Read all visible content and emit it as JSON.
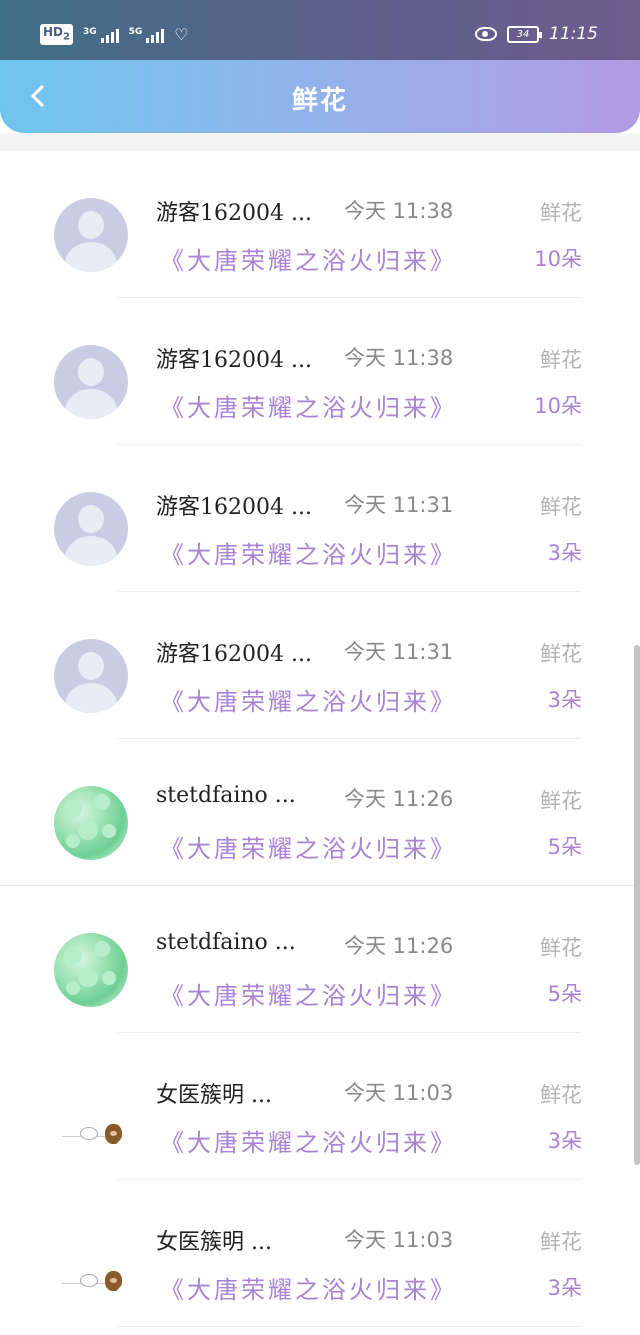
{
  "status_bar": {
    "hd": "HD",
    "hd_sim": "2",
    "sig1_label": "3G",
    "sig2_label": "5G",
    "battery": "34",
    "time": "11:15"
  },
  "header": {
    "title": "鲜花",
    "back_icon": "chevron-left-icon"
  },
  "records": [
    {
      "user": "游客162004 ...",
      "time": "今天 11:38",
      "type": "鲜花",
      "book": "《大唐荣耀之浴火归来》",
      "count": "10朵",
      "avatar": "default"
    },
    {
      "user": "游客162004 ...",
      "time": "今天 11:38",
      "type": "鲜花",
      "book": "《大唐荣耀之浴火归来》",
      "count": "10朵",
      "avatar": "default"
    },
    {
      "user": "游客162004 ...",
      "time": "今天 11:31",
      "type": "鲜花",
      "book": "《大唐荣耀之浴火归来》",
      "count": "3朵",
      "avatar": "default"
    },
    {
      "user": "游客162004 ...",
      "time": "今天 11:31",
      "type": "鲜花",
      "book": "《大唐荣耀之浴火归来》",
      "count": "3朵",
      "avatar": "default"
    },
    {
      "user": "stetdfaino ...",
      "time": "今天 11:26",
      "type": "鲜花",
      "book": "《大唐荣耀之浴火归来》",
      "count": "5朵",
      "avatar": "petals"
    },
    {
      "user": "stetdfaino ...",
      "time": "今天 11:26",
      "type": "鲜花",
      "book": "《大唐荣耀之浴火归来》",
      "count": "5朵",
      "avatar": "petals"
    },
    {
      "user": "女医簇明 ...",
      "time": "今天 11:03",
      "type": "鲜花",
      "book": "《大唐荣耀之浴火归来》",
      "count": "3朵",
      "avatar": "sticker"
    },
    {
      "user": "女医簇明 ...",
      "time": "今天 11:03",
      "type": "鲜花",
      "book": "《大唐荣耀之浴火归来》",
      "count": "3朵",
      "avatar": "sticker"
    }
  ]
}
